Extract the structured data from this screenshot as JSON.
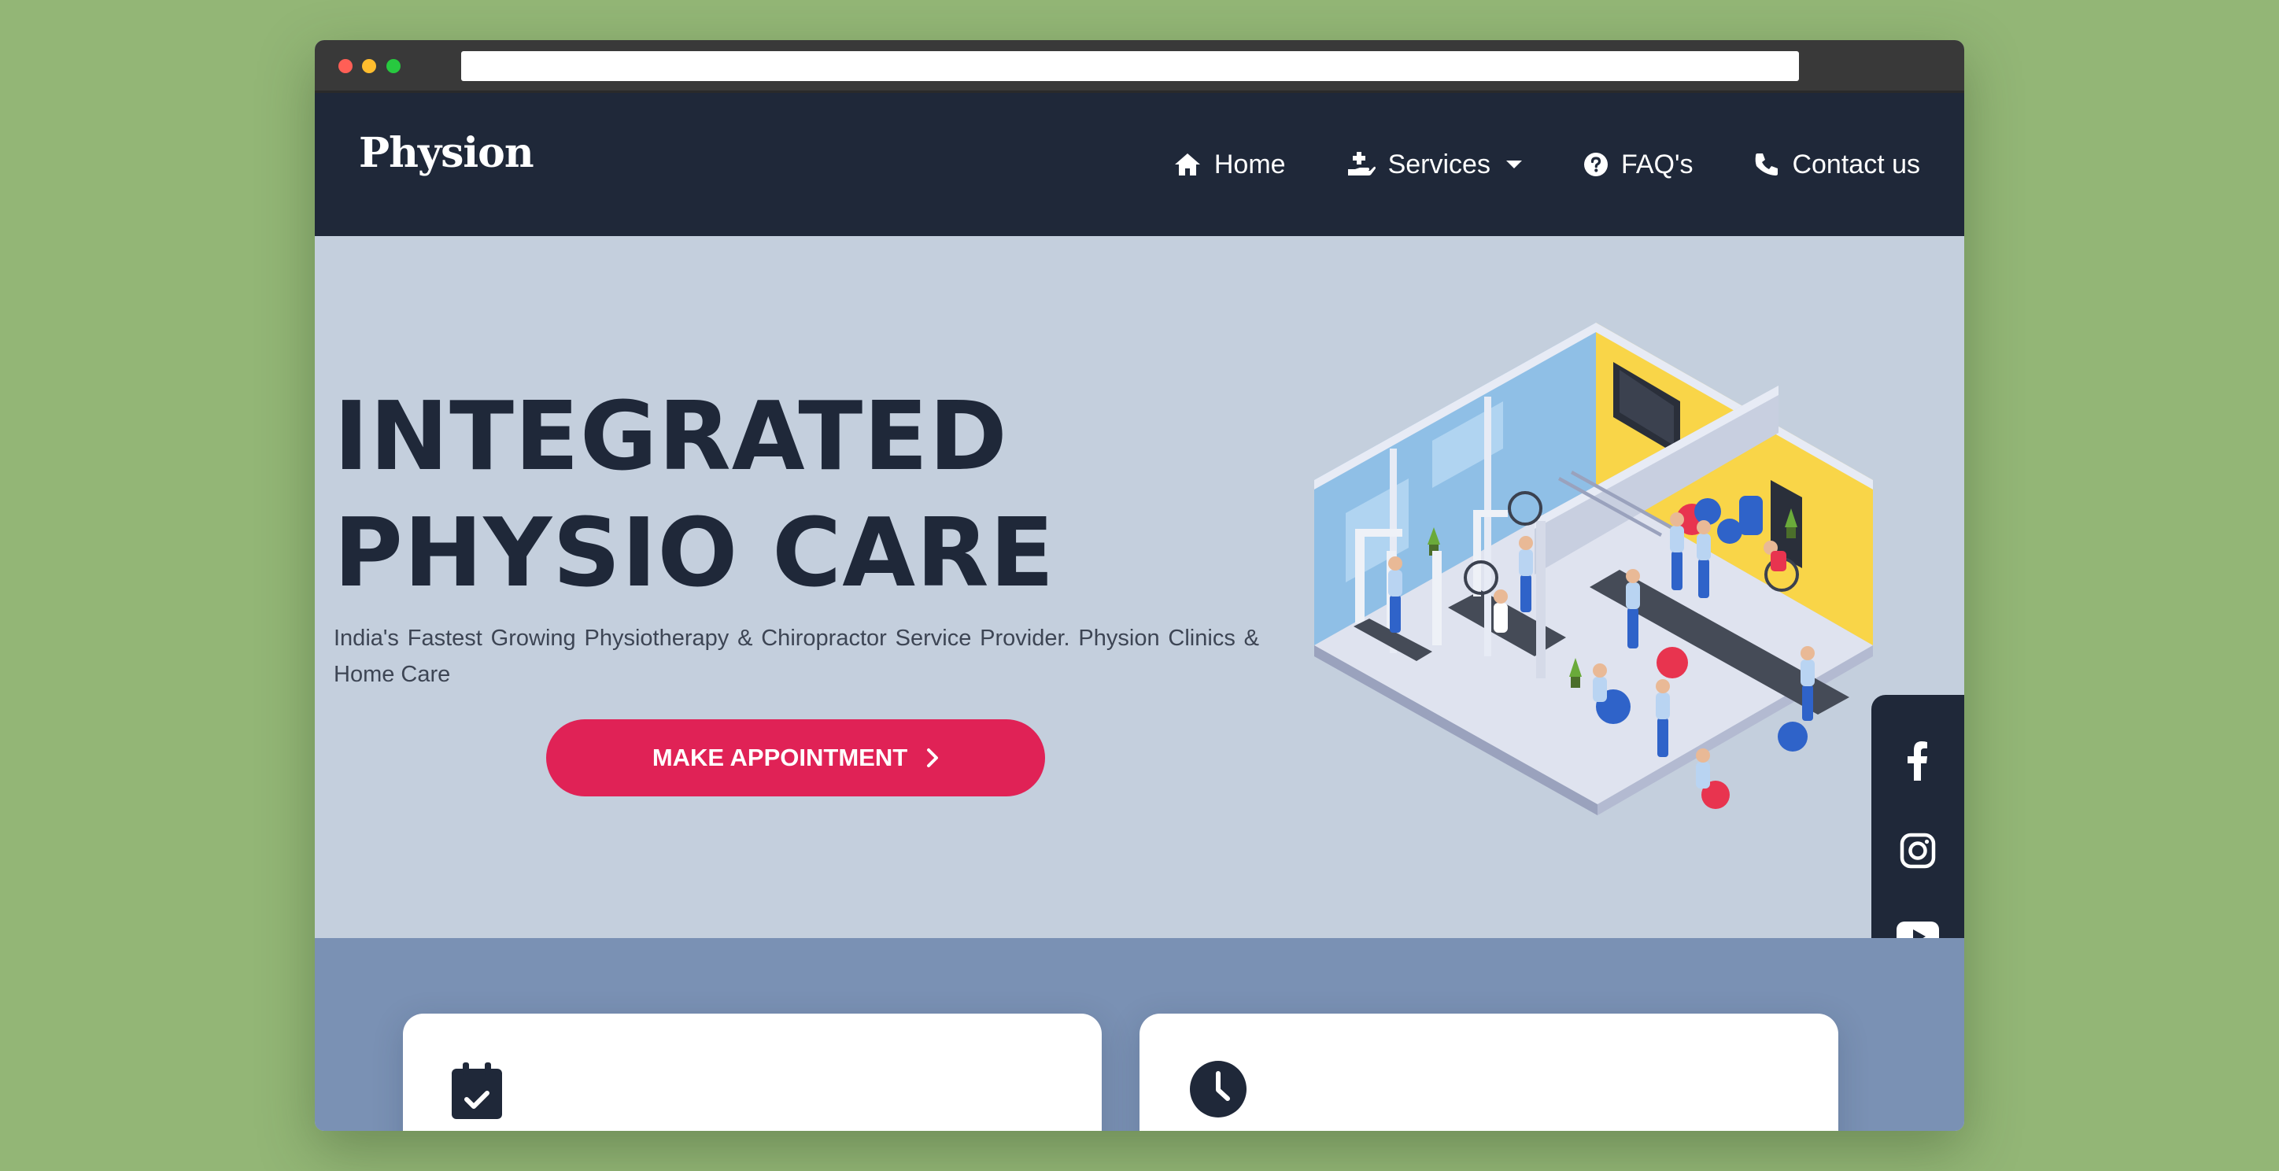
{
  "navbar": {
    "brand": "Physion",
    "items": [
      {
        "label": "Home",
        "icon": "home-icon"
      },
      {
        "label": "Services",
        "icon": "hand-medical-icon",
        "dropdown": true
      },
      {
        "label": "FAQ's",
        "icon": "question-circle-icon"
      },
      {
        "label": "Contact us",
        "icon": "phone-icon"
      }
    ]
  },
  "hero": {
    "title_line1": "INTEGRATED",
    "title_line2": "PHYSIO CARE",
    "subtitle": "India's Fastest Growing Physiotherapy & Chiropractor Service Provider. Physion Clinics & Home Care",
    "cta_label": "MAKE APPOINTMENT",
    "illustration": "isometric physiotherapy clinic"
  },
  "social": [
    {
      "icon": "facebook-icon"
    },
    {
      "icon": "instagram-icon"
    },
    {
      "icon": "youtube-icon"
    }
  ],
  "features": [
    {
      "icon": "calendar-check-icon"
    },
    {
      "icon": "clock-icon"
    }
  ],
  "colors": {
    "page_background": "#93b676",
    "navbar": "#1f2839",
    "hero_background": "#c4cfdd",
    "accent": "#e02256",
    "features_background": "#7a91b4"
  }
}
